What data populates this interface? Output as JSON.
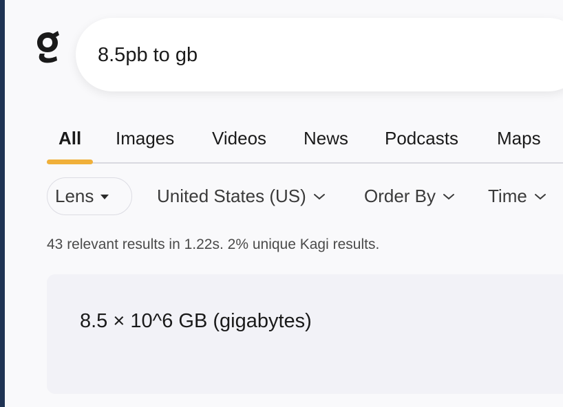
{
  "search": {
    "query": "8.5pb to gb",
    "placeholder": ""
  },
  "tabs": [
    {
      "label": "All",
      "active": true
    },
    {
      "label": "Images"
    },
    {
      "label": "Videos"
    },
    {
      "label": "News"
    },
    {
      "label": "Podcasts"
    },
    {
      "label": "Maps"
    }
  ],
  "filters": {
    "lens_label": "Lens",
    "region_label": "United States (US)",
    "order_label": "Order By",
    "time_label": "Time"
  },
  "stats_text": "43 relevant results in 1.22s. 2% unique Kagi results.",
  "answer": {
    "text": "8.5 × 10^6 GB (gigabytes)"
  },
  "colors": {
    "accent": "#f0b03a",
    "background": "#f9f9fb",
    "card": "#f2f2f7",
    "left_edge": "#1f3354"
  },
  "icons": {
    "logo": "kagi-logo",
    "lens_caret": "caret-down-icon",
    "dropdown": "chevron-down-icon"
  }
}
